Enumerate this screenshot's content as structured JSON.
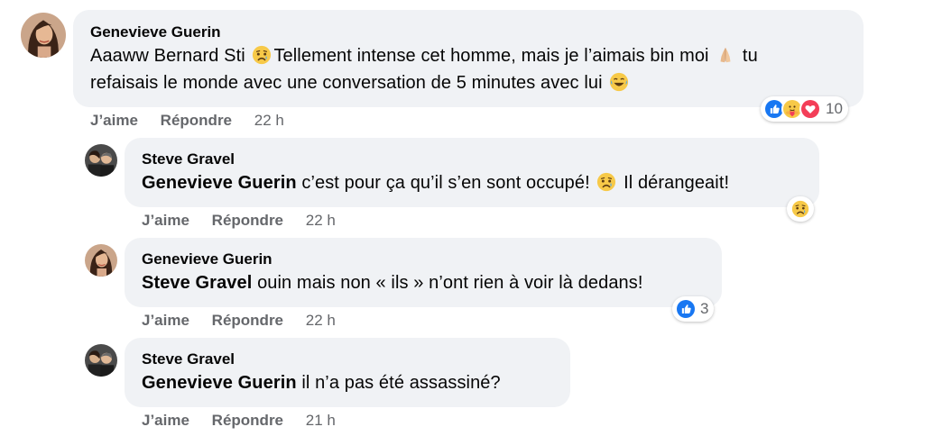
{
  "colors": {
    "bubble": "#f0f2f5",
    "secondary": "#65676b",
    "like": "#1877f2",
    "love": "#f33e58",
    "sad": "#f7b125"
  },
  "comments": [
    {
      "author": "Genevieve Guerin",
      "line1_a": "Aaaww Bernard Sti ",
      "line1_b": "Tellement intense cet homme, mais je l’aimais bin moi ",
      "line1_c": " tu",
      "line2_a": "refaisais le monde avec une conversation de 5 minutes avec lui ",
      "like": "J’aime",
      "reply": "Répondre",
      "time": "22 h",
      "reactions": {
        "icons": [
          "like-icon",
          "care-icon",
          "love-icon"
        ],
        "count": "10"
      }
    },
    {
      "author": "Steve Gravel",
      "mention": "Genevieve Guerin",
      "text_a": " c’est pour ça qu’il s’en sont occupé! ",
      "text_b": " Il dérangeait!",
      "like": "J’aime",
      "reply": "Répondre",
      "time": "22 h",
      "reactions": {
        "icons": [
          "sad-icon"
        ]
      }
    },
    {
      "author": "Genevieve Guerin",
      "mention": "Steve Gravel",
      "text": " ouin mais non « ils » n’ont rien à voir là dedans!",
      "like": "J’aime",
      "reply": "Répondre",
      "time": "22 h",
      "reactions": {
        "icons": [
          "like-icon"
        ],
        "count": "3"
      }
    },
    {
      "author": "Steve Gravel",
      "mention": "Genevieve Guerin",
      "text": " il n’a pas été assassiné?",
      "like": "J’aime",
      "reply": "Répondre",
      "time": "21 h"
    }
  ]
}
